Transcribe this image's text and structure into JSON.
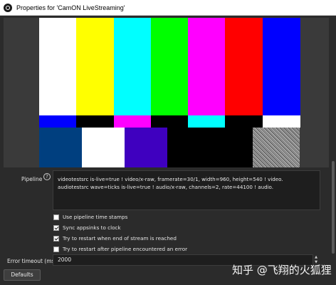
{
  "window": {
    "title": "Properties for 'CamON LiveStreaming'"
  },
  "preview": {
    "top_bar_colors": [
      "#ffffff",
      "#ffff00",
      "#00ffff",
      "#00ff00",
      "#ff00ff",
      "#ff0000",
      "#0000ff"
    ],
    "middle_bar_colors": [
      "#0000ff",
      "#000000",
      "#ff00ff",
      "#000000",
      "#00ffff",
      "#000000",
      "#ffffff"
    ],
    "bottom_bar_colors": [
      "#003f7f",
      "#ffffff",
      "#3f00bf",
      "#000000",
      "#000000",
      "#000000",
      "#8a8a8a"
    ]
  },
  "pipeline": {
    "label": "Pipeline",
    "help_icon": "?",
    "text": "videotestsrc is-live=true ! video/x-raw, framerate=30/1, width=960, height=540 ! video. audiotestsrc wave=ticks is-live=true ! audio/x-raw, channels=2, rate=44100 ! audio."
  },
  "options": [
    {
      "label": "Use pipeline time stamps",
      "checked": false
    },
    {
      "label": "Sync appsinks to clock",
      "checked": true
    },
    {
      "label": "Try to restart when end of stream is reached",
      "checked": true
    },
    {
      "label": "Try to restart after pipeline encountered an error",
      "checked": false
    }
  ],
  "error_timeout": {
    "label": "Error timeout (ms)",
    "value": "2000"
  },
  "buttons": {
    "defaults": "Defaults"
  },
  "watermark": {
    "text": "知乎 @飞翔的火狐狸"
  }
}
